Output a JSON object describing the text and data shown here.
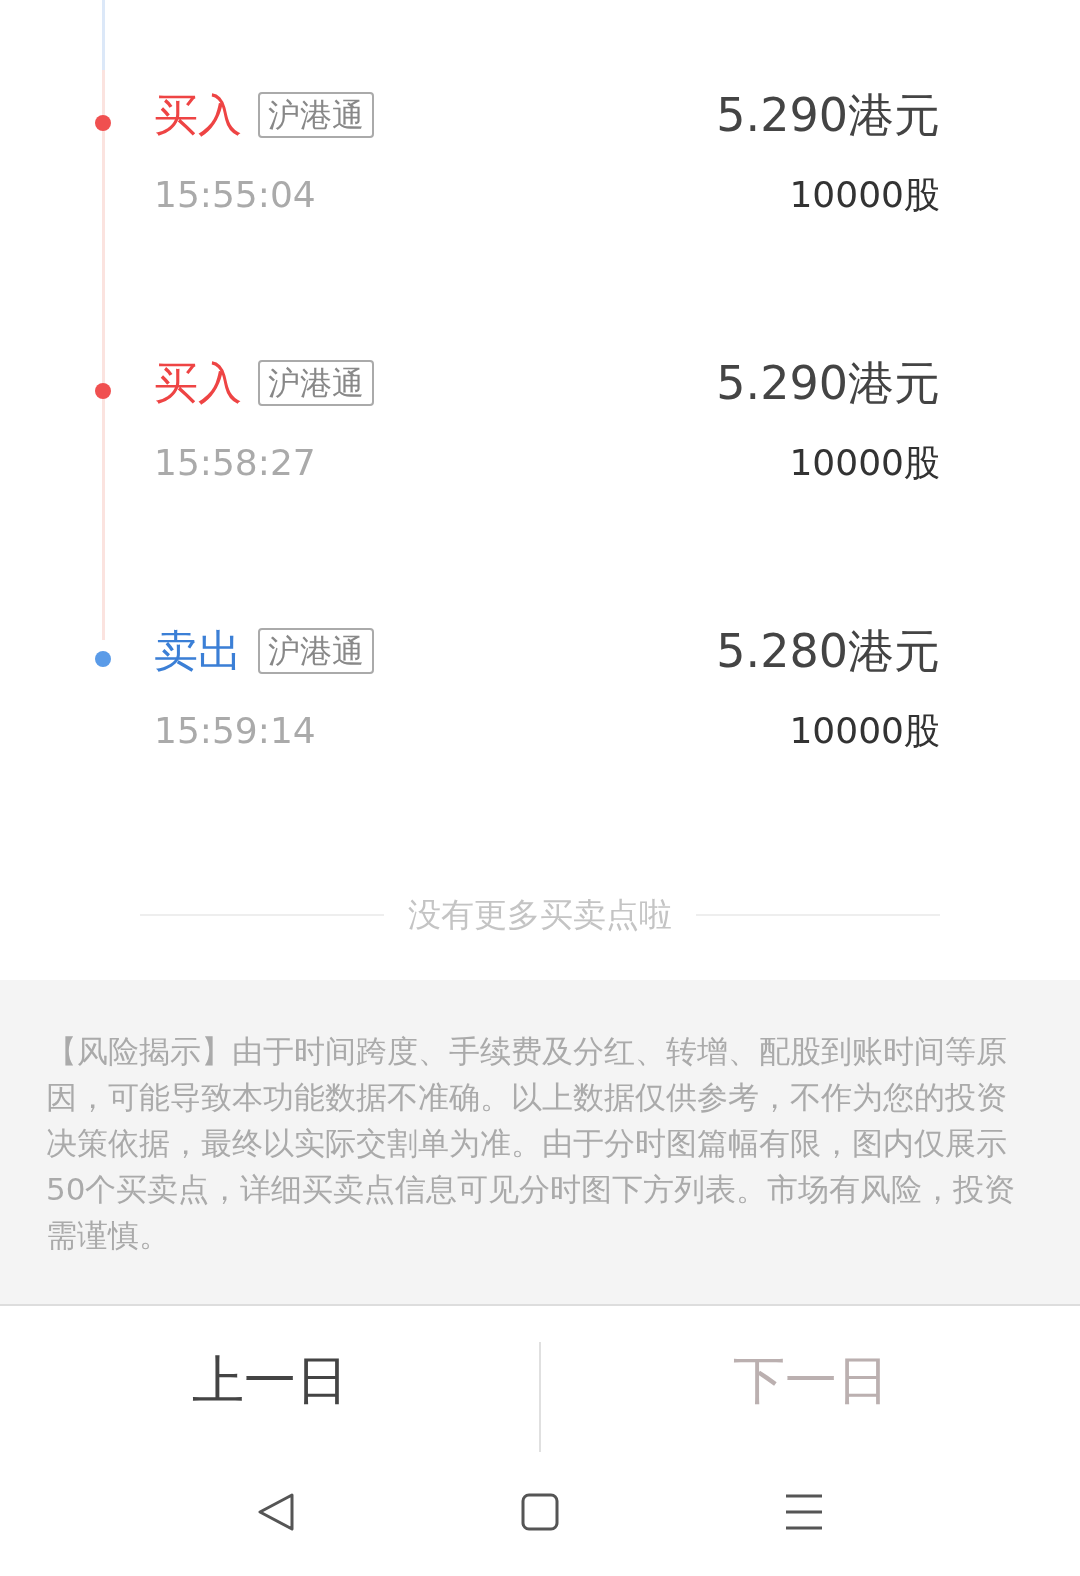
{
  "trades": [
    {
      "kind": "buy",
      "type": "买入",
      "badge": "沪港通",
      "price": "5.290港元",
      "time": "15:55:04",
      "shares": "10000股"
    },
    {
      "kind": "buy",
      "type": "买入",
      "badge": "沪港通",
      "price": "5.290港元",
      "time": "15:58:27",
      "shares": "10000股"
    },
    {
      "kind": "sell",
      "type": "卖出",
      "badge": "沪港通",
      "price": "5.280港元",
      "time": "15:59:14",
      "shares": "10000股"
    }
  ],
  "end_note": "没有更多买卖点啦",
  "disclaimer": "【风险揭示】由于时间跨度、手续费及分红、转增、配股到账时间等原因，可能导致本功能数据不准确。以上数据仅供参考，不作为您的投资决策依据，最终以实际交割单为准。由于分时图篇幅有限，图内仅展示50个买卖点，详细买卖点信息可见分时图下方列表。市场有风险，投资需谨慎。",
  "buttons": [
    {
      "label": "上一日",
      "disabled": false
    },
    {
      "label": "下一日",
      "disabled": true
    }
  ]
}
